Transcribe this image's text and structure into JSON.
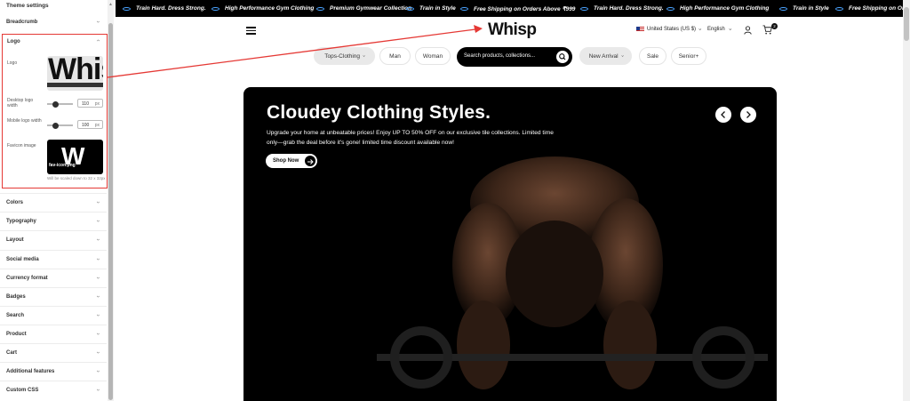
{
  "panel": {
    "title": "Theme settings",
    "breadcrumb": "Breadcrumb",
    "logo_section": {
      "title": "Logo",
      "logo_label": "Logo",
      "logo_preview_text": "Whis",
      "desktop_label": "Desktop logo width",
      "desktop_value": "110",
      "mobile_label": "Mobile logo width",
      "mobile_value": "100",
      "unit": "px",
      "favicon_label": "Favicon image",
      "favicon_preview_letter": "W",
      "favicon_preview_text": "fav-icon.png",
      "favicon_note": "Will be scaled down to 32 x 32px"
    },
    "sections": [
      "Colors",
      "Typography",
      "Layout",
      "Social media",
      "Currency format",
      "Badges",
      "Search",
      "Product",
      "Cart",
      "Additional features",
      "Custom CSS"
    ]
  },
  "ticker": [
    "Train Hard. Dress Strong.",
    "High Performance Gym Clothing",
    "Premium Gymwear Collection",
    "Train in Style",
    "Free Shipping on Orders Above ₹999",
    "Train Hard. Dress Strong.",
    "High Performance Gym Clothing",
    "Train in Style",
    "Free Shipping on Orders Ab"
  ],
  "header": {
    "brand": "Whisp",
    "country": "United States (US $)",
    "language": "English",
    "cart_count": "2"
  },
  "nav": {
    "items": [
      "Tops-Clothing",
      "Man",
      "Woman"
    ],
    "search_placeholder": "Search products, collections...",
    "items_right": [
      "New Arrival",
      "Sale",
      "Senior+"
    ]
  },
  "hero": {
    "title": "Cloudey Clothing Styles.",
    "subtitle": "Upgrade your home at unbeatable prices! Enjoy UP TO 50% OFF on our exclusive tile collections. Limited time only—grab the deal before it's gone! limited time discount available now!",
    "cta": "Shop Now"
  },
  "colors": {
    "annotation": "#e53935",
    "ticker_dot": "#4aa3ff"
  }
}
